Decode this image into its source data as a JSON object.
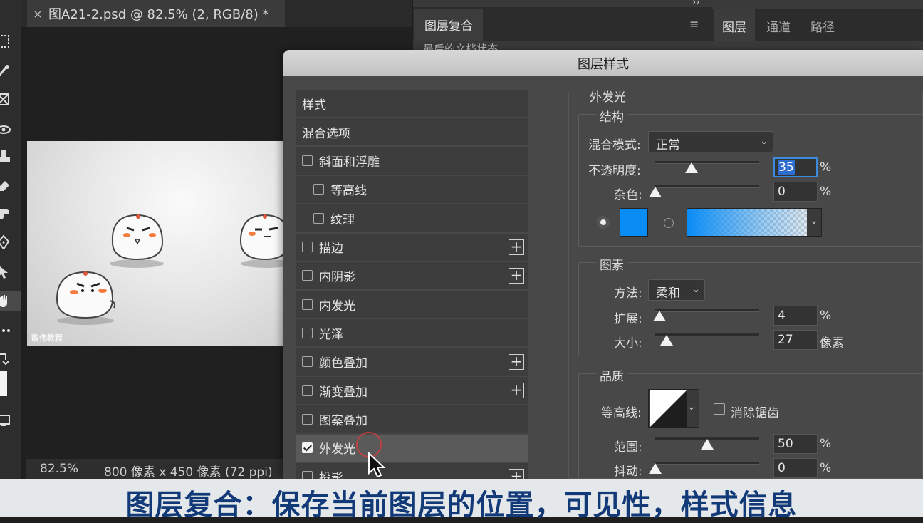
{
  "document": {
    "tab_title": "图A21-2.psd @ 82.5% (2, RGB/8) *",
    "close_glyph": "×",
    "zoom": "82.5%",
    "info": "800 像素 x 450 像素 (72 ppi)",
    "watermark": "敬伟教程"
  },
  "layer_comps_panel": {
    "tab_label": "图层复合",
    "menu_glyph": "≡",
    "row_text": "最后的文档状态"
  },
  "layers_panel": {
    "expand_glyph": "››",
    "tabs": [
      "图层",
      "通道",
      "路径"
    ]
  },
  "dialog": {
    "title": "图层样式",
    "styles": [
      {
        "label": "样式",
        "checkbox": false,
        "checked": false,
        "indent": false,
        "plus": false
      },
      {
        "label": "混合选项",
        "checkbox": false,
        "checked": false,
        "indent": false,
        "plus": false
      },
      {
        "label": "斜面和浮雕",
        "checkbox": true,
        "checked": false,
        "indent": false,
        "plus": false
      },
      {
        "label": "等高线",
        "checkbox": true,
        "checked": false,
        "indent": true,
        "plus": false
      },
      {
        "label": "纹理",
        "checkbox": true,
        "checked": false,
        "indent": true,
        "plus": false
      },
      {
        "label": "描边",
        "checkbox": true,
        "checked": false,
        "indent": false,
        "plus": true
      },
      {
        "label": "内阴影",
        "checkbox": true,
        "checked": false,
        "indent": false,
        "plus": true
      },
      {
        "label": "内发光",
        "checkbox": true,
        "checked": false,
        "indent": false,
        "plus": false
      },
      {
        "label": "光泽",
        "checkbox": true,
        "checked": false,
        "indent": false,
        "plus": false
      },
      {
        "label": "颜色叠加",
        "checkbox": true,
        "checked": false,
        "indent": false,
        "plus": true
      },
      {
        "label": "渐变叠加",
        "checkbox": true,
        "checked": false,
        "indent": false,
        "plus": true
      },
      {
        "label": "图案叠加",
        "checkbox": true,
        "checked": false,
        "indent": false,
        "plus": false
      },
      {
        "label": "外发光",
        "checkbox": true,
        "checked": true,
        "indent": false,
        "plus": false,
        "active": true
      },
      {
        "label": "投影",
        "checkbox": true,
        "checked": false,
        "indent": false,
        "plus": true
      }
    ],
    "outer_glow": {
      "section_title": "外发光",
      "structure": {
        "title": "结构",
        "blend_mode_label": "混合模式:",
        "blend_mode_value": "正常",
        "opacity_label": "不透明度:",
        "opacity_value": "35",
        "opacity_level": 0.35,
        "noise_label": "杂色:",
        "noise_value": "0",
        "noise_level": 0,
        "percent": "%",
        "glow_color": "#0a8cf5"
      },
      "elements": {
        "title": "图素",
        "technique_label": "方法:",
        "technique_value": "柔和",
        "spread_label": "扩展:",
        "spread_value": "4",
        "spread_level": 0.04,
        "size_label": "大小:",
        "size_value": "27",
        "size_unit": "像素",
        "size_level": 0.11,
        "percent": "%"
      },
      "quality": {
        "title": "品质",
        "contour_label": "等高线:",
        "antialias_label": "消除锯齿",
        "range_label": "范围:",
        "range_value": "50",
        "range_level": 0.5,
        "jitter_label": "抖动:",
        "jitter_value": "0",
        "jitter_level": 0,
        "percent": "%"
      }
    }
  },
  "subtitle": "图层复合：保存当前图层的位置，可见性，样式信息",
  "chevron_glyph": "⌄"
}
